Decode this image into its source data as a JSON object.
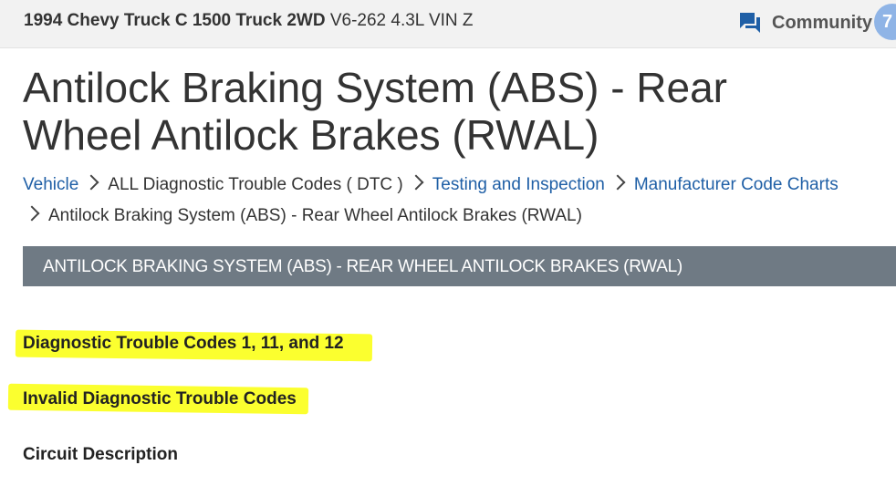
{
  "header": {
    "vehicle_bold": "1994 Chevy Truck C 1500 Truck 2WD",
    "vehicle_engine": "V6-262 4.3L VIN Z",
    "community_label": "Community",
    "avatar_initial": "7"
  },
  "page": {
    "title": "Antilock Braking System (ABS) - Rear Wheel Antilock Brakes (RWAL)"
  },
  "breadcrumb": {
    "items": [
      "Vehicle",
      "ALL Diagnostic Trouble Codes ( DTC )",
      "Testing and Inspection",
      "Manufacturer Code Charts",
      "Antilock Braking System (ABS) - Rear Wheel Antilock Brakes (RWAL)"
    ]
  },
  "section": {
    "bar_title": "ANTILOCK BRAKING SYSTEM (ABS) - REAR WHEEL ANTILOCK BRAKES (RWAL)",
    "headings": [
      "Diagnostic Trouble Codes 1, 11, and 12",
      "Invalid Diagnostic Trouble Codes",
      "Circuit Description"
    ]
  },
  "colors": {
    "link": "#1f5fa6",
    "section_bar": "#6f7a84",
    "highlight": "#fbff2f",
    "community_icon": "#1f5fa6"
  },
  "icons": {
    "community": "chat-bubbles-icon",
    "breadcrumb_separator": "chevron-right-icon"
  }
}
